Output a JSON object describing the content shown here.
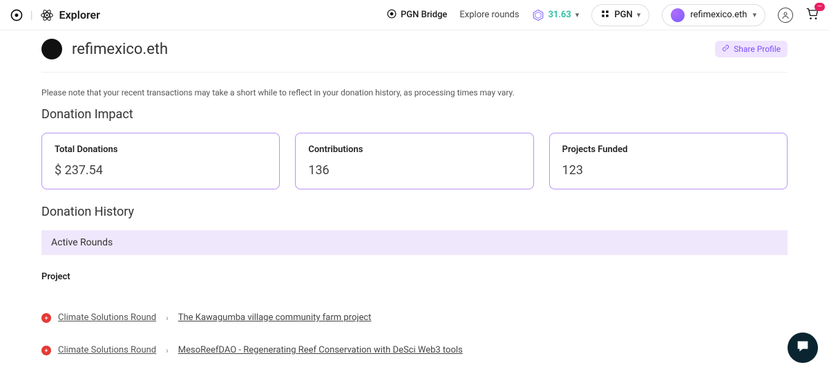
{
  "header": {
    "explorer_label": "Explorer",
    "pgn_bridge": "PGN Bridge",
    "explore_rounds": "Explore rounds",
    "balance": "31.63",
    "network": "PGN",
    "wallet": "refimexico.eth",
    "cart_count": "—"
  },
  "profile": {
    "name": "refimexico.eth",
    "share_label": "Share Profile",
    "note": "Please note that your recent transactions may take a short while to reflect in your donation history, as processing times may vary."
  },
  "impact": {
    "title": "Donation Impact",
    "cards": [
      {
        "label": "Total Donations",
        "value": "$ 237.54"
      },
      {
        "label": "Contributions",
        "value": "136"
      },
      {
        "label": "Projects Funded",
        "value": "123"
      }
    ]
  },
  "history": {
    "title": "Donation History",
    "active_rounds_label": "Active Rounds",
    "project_col": "Project",
    "rows": [
      {
        "round": "Climate Solutions Round",
        "project": "The Kawagumba village community farm project"
      },
      {
        "round": "Climate Solutions Round",
        "project": "MesoReefDAO - Regenerating Reef Conservation with DeSci Web3 tools"
      }
    ]
  }
}
